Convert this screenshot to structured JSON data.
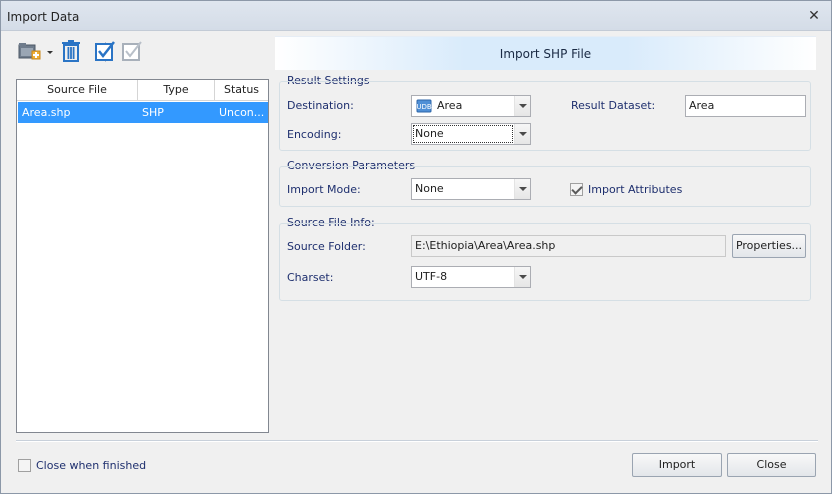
{
  "window": {
    "title": "Import Data"
  },
  "toolbar": {
    "icons": [
      "add-files-icon",
      "dropdown-arrow-icon",
      "delete-icon",
      "select-all-icon",
      "select-none-icon"
    ]
  },
  "file_list": {
    "columns": [
      "Source File",
      "Type",
      "Status"
    ],
    "rows": [
      {
        "source_file": "Area.shp",
        "type": "SHP",
        "status": "Uncon..."
      }
    ]
  },
  "banner": {
    "title": "Import SHP File"
  },
  "result_settings": {
    "title": "Result Settings",
    "destination_label": "Destination:",
    "destination_value": "Area",
    "result_dataset_label": "Result Dataset:",
    "result_dataset_value": "Area",
    "encoding_label": "Encoding:",
    "encoding_value": "None"
  },
  "conversion": {
    "title": "Conversion Parameters",
    "import_mode_label": "Import Mode:",
    "import_mode_value": "None",
    "import_attributes_label": "Import Attributes",
    "import_attributes_checked": true
  },
  "source_info": {
    "title": "Source File Info:",
    "folder_label": "Source Folder:",
    "folder_value": "E:\\Ethiopia\\Area\\Area.shp",
    "properties_label": "Properties...",
    "charset_label": "Charset:",
    "charset_value": "UTF-8"
  },
  "footer": {
    "close_when_finished_label": "Close when finished",
    "close_when_finished_checked": false,
    "import_label": "Import",
    "close_label": "Close"
  },
  "colors": {
    "selection": "#3399ff",
    "group_text": "#1e2f6e",
    "banner": "#d9ebfb"
  }
}
